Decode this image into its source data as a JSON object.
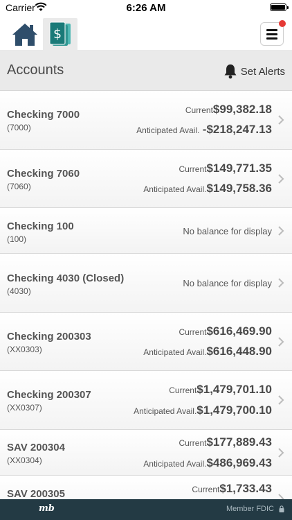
{
  "status_bar": {
    "carrier": "Carrier",
    "time": "6:26 AM",
    "battery_level": 1.0
  },
  "header": {
    "home_icon": "home-icon",
    "accounts_icon": "accounts-dollar-icon",
    "menu_icon": "hamburger-menu-icon",
    "menu_badge": true
  },
  "title_bar": {
    "title": "Accounts",
    "alerts_label": "Set Alerts",
    "alerts_icon": "bell-icon"
  },
  "accounts": [
    {
      "name": "Checking 7000",
      "number": "(7000)",
      "current_label": "Current",
      "current_value": "$99,382.18",
      "anticipated_label": "Anticipated Avail.",
      "anticipated_value": "-$218,247.13"
    },
    {
      "name": "Checking 7060",
      "number": "(7060)",
      "current_label": "Current",
      "current_value": "$149,771.35",
      "anticipated_label": "Anticipated Avail.",
      "anticipated_value": "$149,758.36"
    },
    {
      "name": "Checking 100",
      "number": "(100)",
      "no_balance": "No balance for display"
    },
    {
      "name": "Checking 4030 (Closed)",
      "number": "(4030)",
      "no_balance": "No balance for display"
    },
    {
      "name": "Checking 200303",
      "number": "(XX0303)",
      "current_label": "Current",
      "current_value": "$616,469.90",
      "anticipated_label": "Anticipated Avail.",
      "anticipated_value": "$616,448.90"
    },
    {
      "name": "Checking 200307",
      "number": "(XX0307)",
      "current_label": "Current",
      "current_value": "$1,479,701.10",
      "anticipated_label": "Anticipated Avail.",
      "anticipated_value": "$1,479,700.10"
    },
    {
      "name": "SAV 200304",
      "number": "(XX0304)",
      "current_label": "Current",
      "current_value": "$177,889.43",
      "anticipated_label": "Anticipated Avail.",
      "anticipated_value": "$486,969.43"
    },
    {
      "name": "SAV 200305",
      "number": "",
      "current_label": "Current",
      "current_value": "$1,733.43"
    }
  ],
  "footer": {
    "logo": "mb",
    "fdic": "Member FDIC",
    "lock_icon": "lock-icon"
  },
  "colors": {
    "footer_bg": "#233a44",
    "title_bar_bg": "#eaeaea",
    "accent_teal": "#1a7a78",
    "home_icon": "#2f4e6b",
    "badge_red": "#e53935"
  }
}
